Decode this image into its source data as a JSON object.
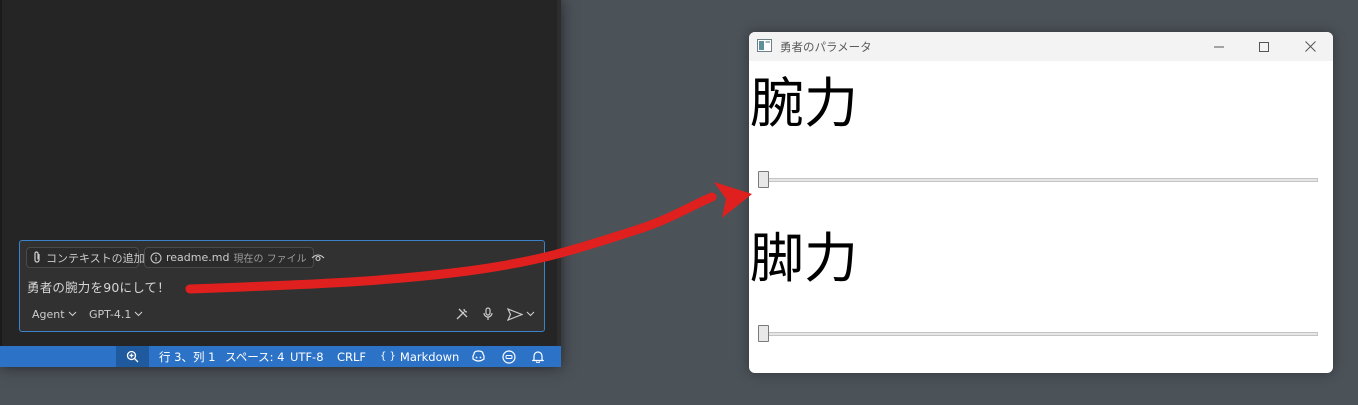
{
  "vscode": {
    "chat": {
      "context_chip_label": "コンテキストの追加...",
      "file_chip_name": "readme.md",
      "file_chip_note": "現在の ファイル",
      "prompt_text": "勇者の腕力を90にして！",
      "mode_label": "Agent",
      "model_label": "GPT-4.1"
    },
    "statusbar": {
      "position": "行 3、列 1",
      "indent": "スペース: 4",
      "encoding": "UTF-8",
      "eol": "CRLF",
      "language": "Markdown",
      "language_icon": "{ }"
    }
  },
  "app": {
    "window_title": "勇者のパラメータ",
    "strength_label": "腕力",
    "strength_value_fraction": 0.0,
    "legs_label": "脚力",
    "legs_value_fraction": 0.0
  },
  "colors": {
    "statusbar": "#2c73c8",
    "annotation_arrow": "#e0201e",
    "chat_border": "#3b82c8"
  }
}
